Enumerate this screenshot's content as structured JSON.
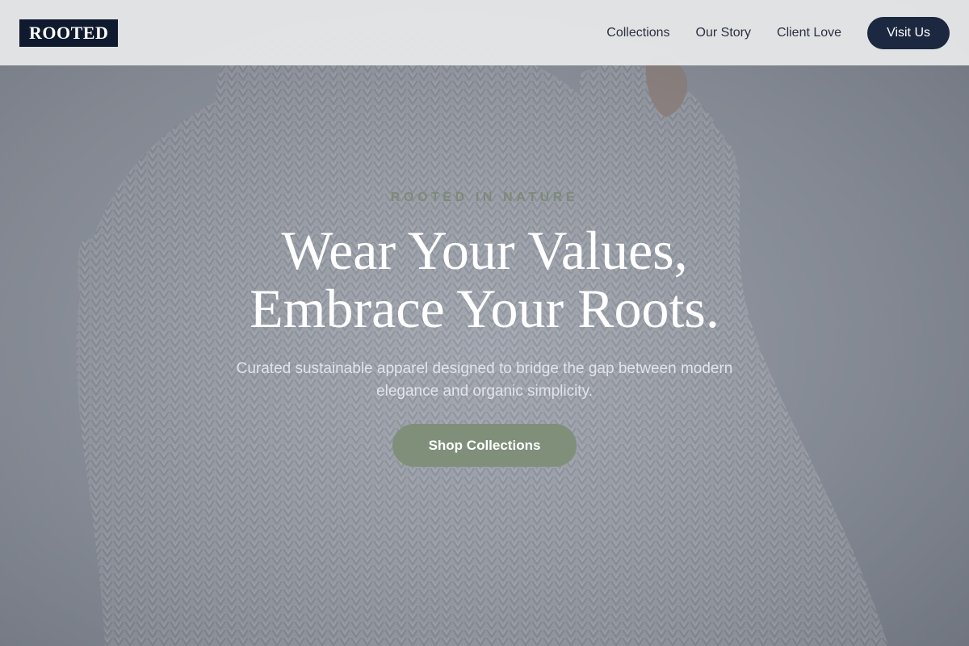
{
  "header": {
    "logo_text": "ROOTED",
    "nav": [
      {
        "label": "Collections"
      },
      {
        "label": "Our Story"
      },
      {
        "label": "Client Love"
      }
    ],
    "cta_label": "Visit Us"
  },
  "hero": {
    "eyebrow": "ROOTED IN NATURE",
    "headline_line1": "Wear Your Values,",
    "headline_line2": "Embrace Your Roots.",
    "subtext": "Curated sustainable apparel designed to bridge the gap between modern elegance and organic simplicity.",
    "cta_label": "Shop Collections",
    "background_image": "grey-knit-sweater-photo"
  },
  "colors": {
    "brand_navy": "#0f1a2e",
    "button_navy": "#1c2840",
    "sage_green": "#7f8f7a",
    "eyebrow_green": "#7d8a78"
  }
}
